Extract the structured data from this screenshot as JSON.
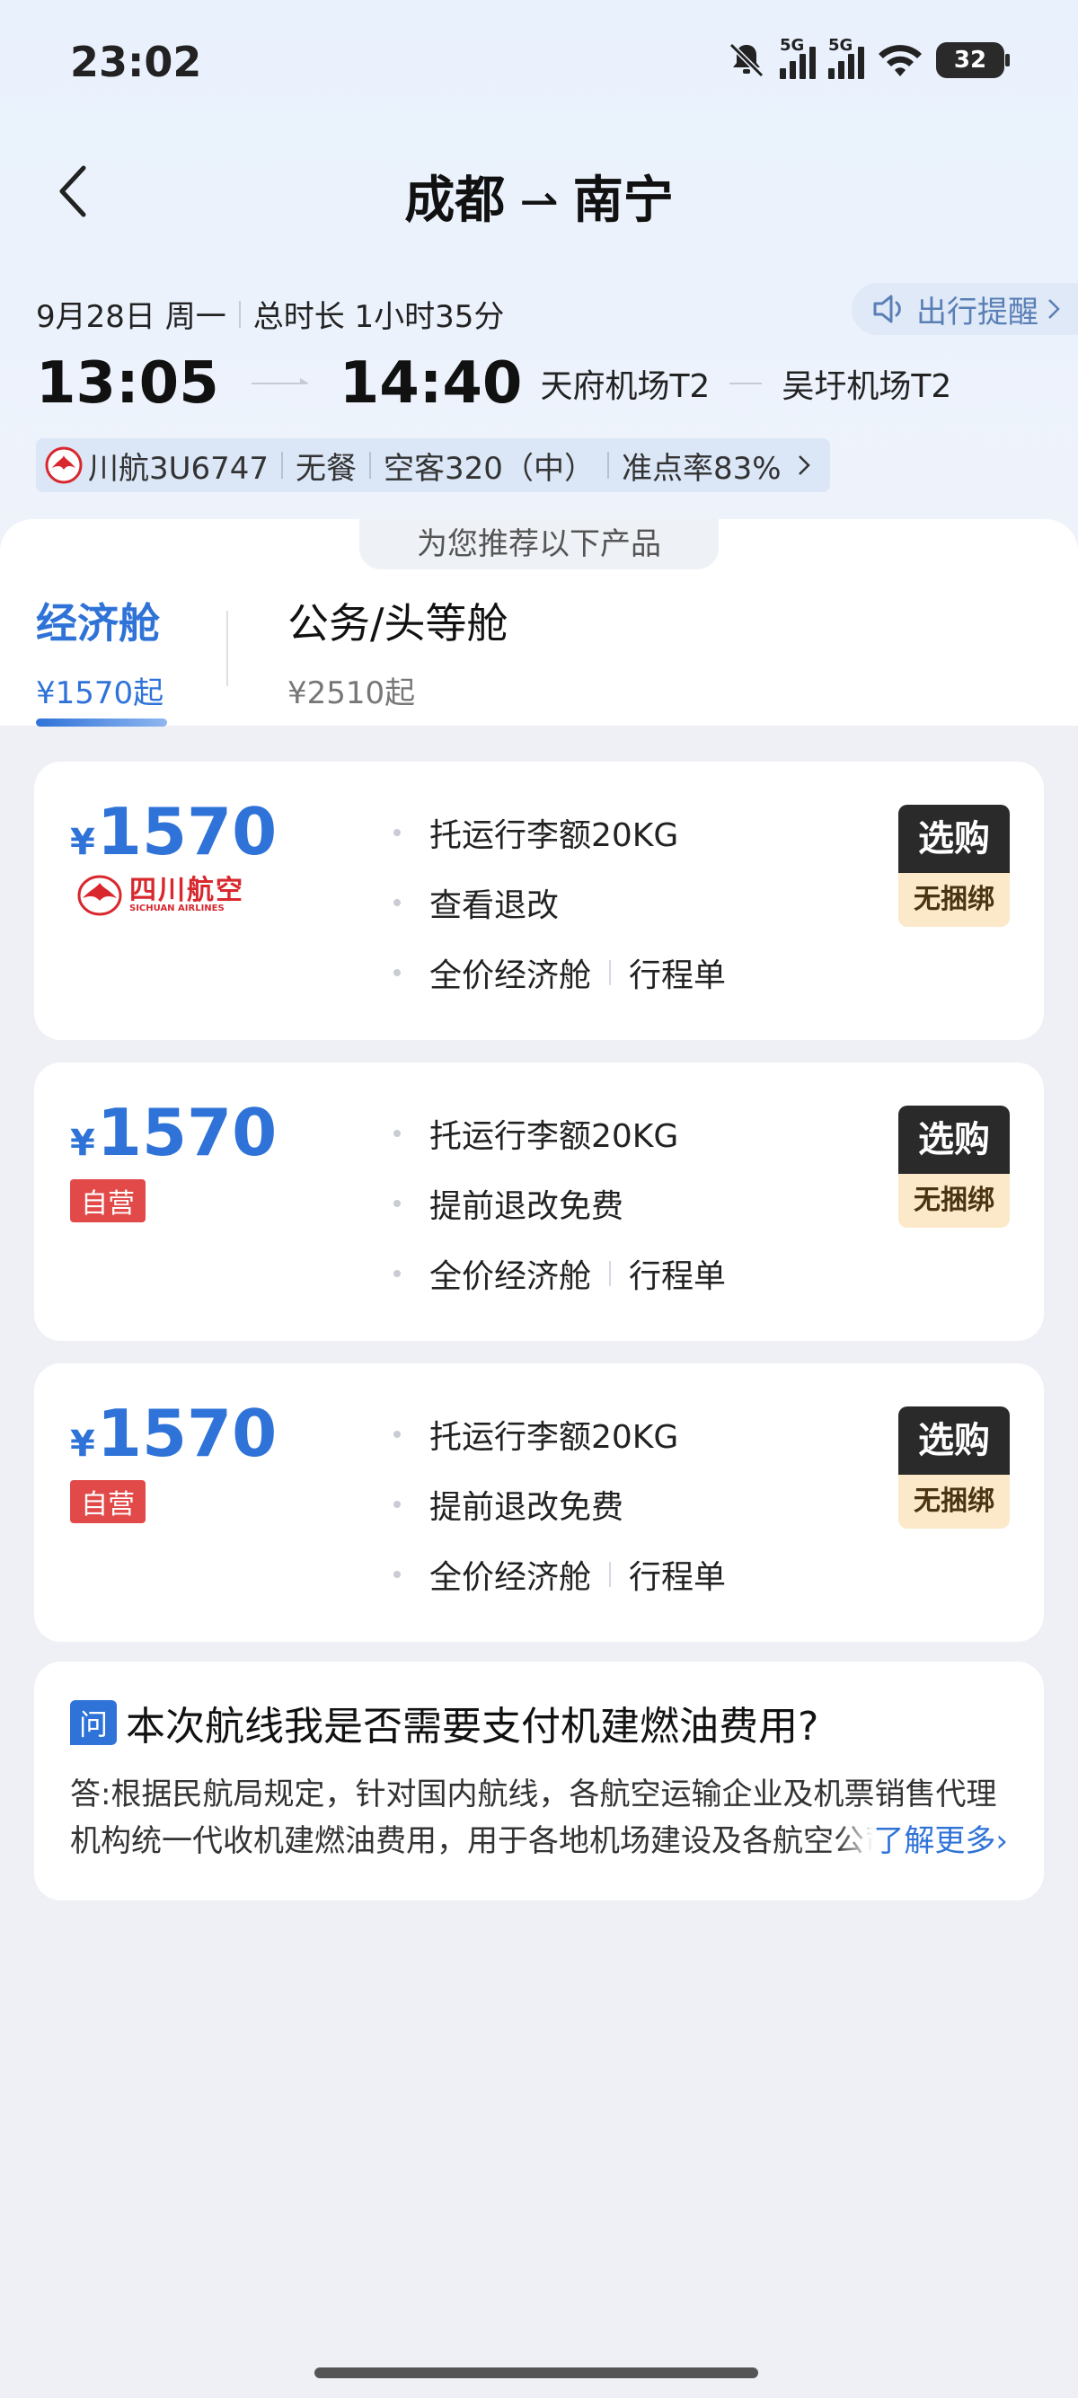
{
  "status_bar": {
    "time": "23:02",
    "net1": "5G",
    "net2": "5G",
    "battery": "32"
  },
  "header": {
    "from": "成都",
    "to": "南宁",
    "arrow": "⇀"
  },
  "flight": {
    "date": "9月28日 周一",
    "duration": "总时长 1小时35分",
    "remind_label": "出行提醒",
    "depart_time": "13:05",
    "arrive_time": "14:40",
    "depart_airport": "天府机场T2",
    "arrive_airport": "吴圩机场T2",
    "airline": "川航3U6747",
    "meal": "无餐",
    "aircraft": "空客320（中）",
    "on_time": "准点率83%"
  },
  "recommend_label": "为您推荐以下产品",
  "tabs": [
    {
      "name": "经济舱",
      "price": "¥1570起"
    },
    {
      "name": "公务/头等舱",
      "price": "¥2510起"
    }
  ],
  "fares": [
    {
      "yen": "¥",
      "price": "1570",
      "logo_text": "四川航空",
      "logo_sub": "SICHUAN AIRLINES",
      "feature1": "托运行李额20KG",
      "feature2": "查看退改",
      "feature3a": "全价经济舱",
      "feature3b": "行程单",
      "buy": "选购",
      "tag": "无捆绑"
    },
    {
      "yen": "¥",
      "price": "1570",
      "badge": "自营",
      "feature1": "托运行李额20KG",
      "feature2": "提前退改免费",
      "feature3a": "全价经济舱",
      "feature3b": "行程单",
      "buy": "选购",
      "tag": "无捆绑"
    },
    {
      "yen": "¥",
      "price": "1570",
      "badge": "自营",
      "feature1": "托运行李额20KG",
      "feature2": "提前退改免费",
      "feature3a": "全价经济舱",
      "feature3b": "行程单",
      "buy": "选购",
      "tag": "无捆绑"
    }
  ],
  "faq": {
    "icon": "问",
    "question": "本次航线我是否需要支付机建燃油费用?",
    "answer": "答:根据民航局规定，针对国内航线，各航空运输企业及机票销售代理机构统一代收机建燃油费用，用于各地机场建设及各航空公司燃油成本",
    "more": "了解更多›"
  },
  "colors": {
    "accent": "#2f73d8",
    "badge_red": "#e24a4a",
    "tag_bg": "#fbe9c9"
  }
}
